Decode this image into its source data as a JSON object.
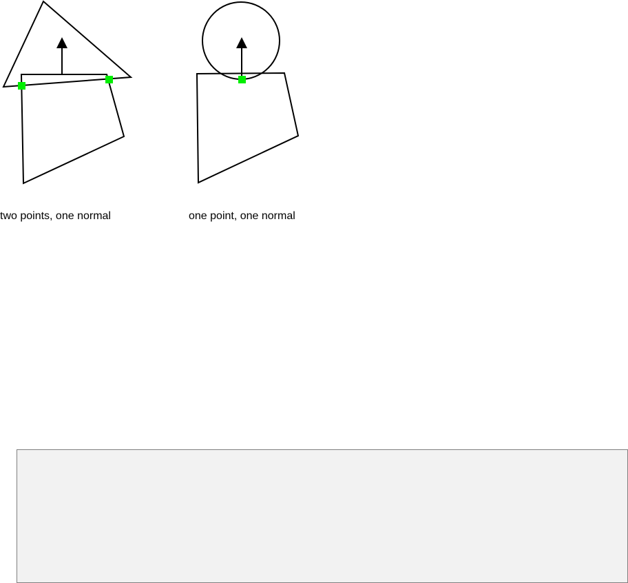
{
  "captions": {
    "two_point_case": "two points, one normal",
    "one_point_case": "one point, one normal"
  },
  "colors": {
    "stroke": "#000000",
    "contact_point": "#00ee00",
    "panel_fill": "#f2f2f2",
    "panel_border": "#7f7f7f"
  },
  "icons": {
    "contact_point": "green-square-marker",
    "normal": "up-arrow"
  }
}
